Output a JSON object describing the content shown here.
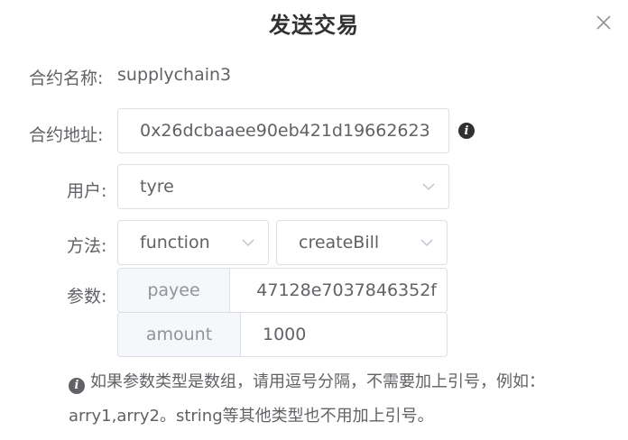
{
  "dialog": {
    "title": "发送交易"
  },
  "contract_name": {
    "label": "合约名称:",
    "value": "supplychain3"
  },
  "contract_address": {
    "label": "合约地址:",
    "value": "0x26dcbaaee90eb421d19662623"
  },
  "user": {
    "label": "用户:",
    "value": "tyre"
  },
  "method": {
    "label": "方法:",
    "type_value": "function",
    "name_value": "createBill"
  },
  "params": {
    "label": "参数:",
    "items": [
      {
        "name": "payee",
        "value": "47128e7037846352f"
      },
      {
        "name": "amount",
        "value": "1000"
      }
    ]
  },
  "tip": {
    "text": "如果参数类型是数组，请用逗号分隔，不需要加上引号，例如：arry1,arry2。string等其他类型也不用加上引号。"
  },
  "icons": {
    "close": "close-icon",
    "info": "info-icon",
    "dropdown": "chevron-down-icon"
  }
}
